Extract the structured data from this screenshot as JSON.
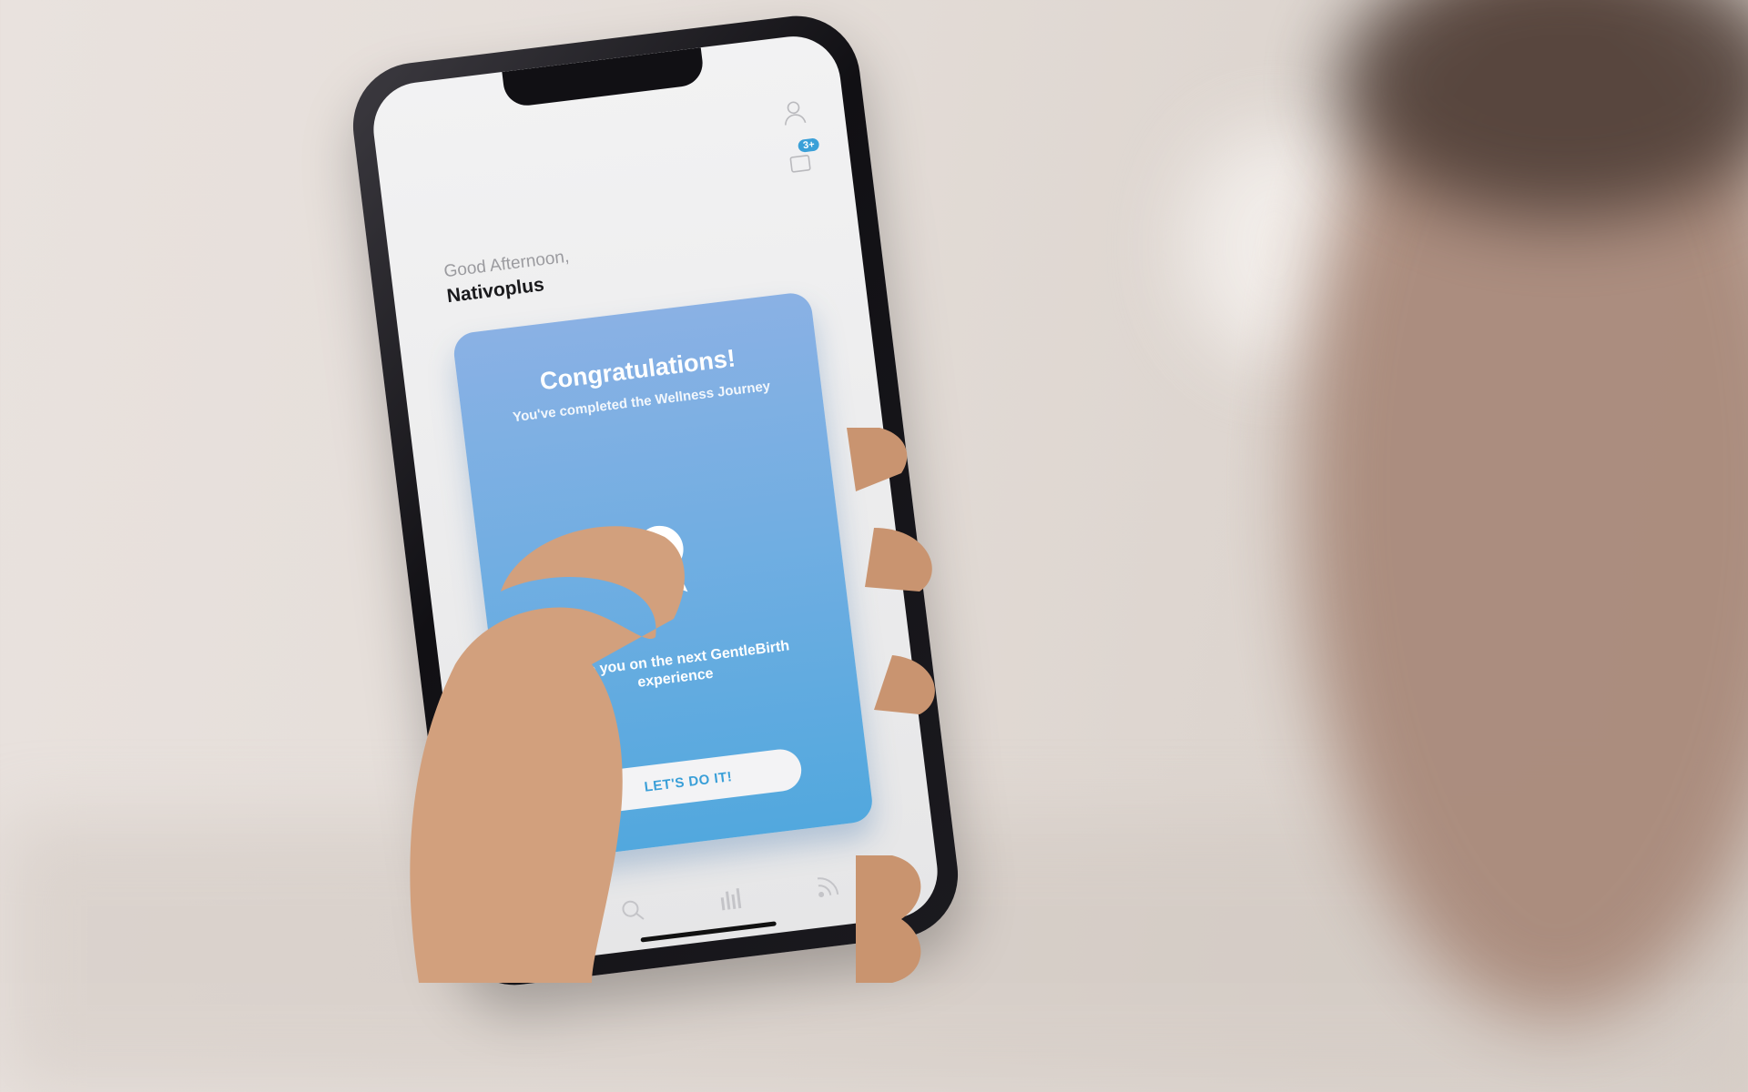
{
  "home": {
    "greeting": "Good Afternoon,",
    "username": "Nativoplus",
    "notification_badge": "3+"
  },
  "card": {
    "title": "Congratulations!",
    "subtitle": "You've completed the Wellness Journey",
    "body": "guide you on the next GentleBirth experience",
    "button_label": "LET'S DO IT!"
  },
  "tabbar": {
    "items": [
      "home-icon",
      "search-icon",
      "stats-icon",
      "feed-icon"
    ],
    "active": "home-icon"
  },
  "colors": {
    "accent": "#3aa0d8",
    "card_top": "#8ab1e4",
    "card_bottom": "#52a8de"
  }
}
